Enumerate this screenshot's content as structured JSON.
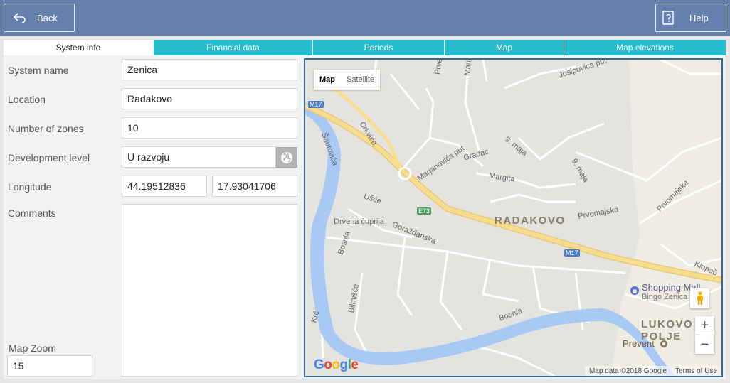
{
  "topbar": {
    "back_label": "Back",
    "help_label": "Help"
  },
  "tabs": [
    {
      "label": "System info",
      "active": true
    },
    {
      "label": "Financial data",
      "active": false
    },
    {
      "label": "Periods",
      "active": false
    },
    {
      "label": "Map",
      "active": false
    },
    {
      "label": "Map elevations",
      "active": false
    }
  ],
  "form": {
    "system_name": {
      "label": "System name",
      "value": "Zenica"
    },
    "location": {
      "label": "Location",
      "value": "Radakovo"
    },
    "zones": {
      "label": "Number of zones",
      "value": "10"
    },
    "development": {
      "label": "Development level",
      "value": "U razvoju"
    },
    "longitude": {
      "label": "Longitude",
      "value1": "44.19512836",
      "value2": "17.93041706"
    },
    "comments": {
      "label": "Comments",
      "value": ""
    },
    "map_zoom": {
      "label": "Map Zoom",
      "value": "15"
    }
  },
  "map": {
    "type_map": "Map",
    "type_satellite": "Satellite",
    "zoom_in": "+",
    "zoom_out": "−",
    "logo": "Google",
    "attribution": "Map data ©2018 Google",
    "terms": "Terms of Use",
    "place_names": {
      "radakovo": "RADAKOVO",
      "lukovo": "LUKOVO POLJE"
    },
    "poi": {
      "mall": "Shopping Mall",
      "mall_sub": "Bingo Zenica",
      "prevent": "Prevent"
    },
    "street_labels": {
      "josipovica": "Josipovica put",
      "prve": "Prve",
      "marij": "Marij",
      "crkvice": "Crkvice",
      "gradac": "Gradac",
      "marjanovica": "Marjanovića put",
      "devet_maja_a": "9. maja",
      "devet_maja_b": "9. maja",
      "margita": "Margita",
      "prvomajska_a": "Prvomajska",
      "prvomajska_b": "Prvomajska",
      "usce": "Ušće",
      "drvena": "Drvena ćuprija",
      "gorazdanska": "Goraždanska",
      "bosnia_a": "Bosnia",
      "bosnia_b": "Bosnia",
      "bilmisce": "Bilmišće",
      "kloch": "Klopač",
      "kr": "Krć",
      "sautovica": "Šautovića"
    },
    "road_shields": {
      "m17_a": "M17",
      "m17_b": "M17",
      "e73": "E73"
    },
    "colors": {
      "road_major": "#f7dd8f",
      "water": "#a9c9f5",
      "land": "#e4e3df",
      "park": "#f0ede5"
    }
  }
}
